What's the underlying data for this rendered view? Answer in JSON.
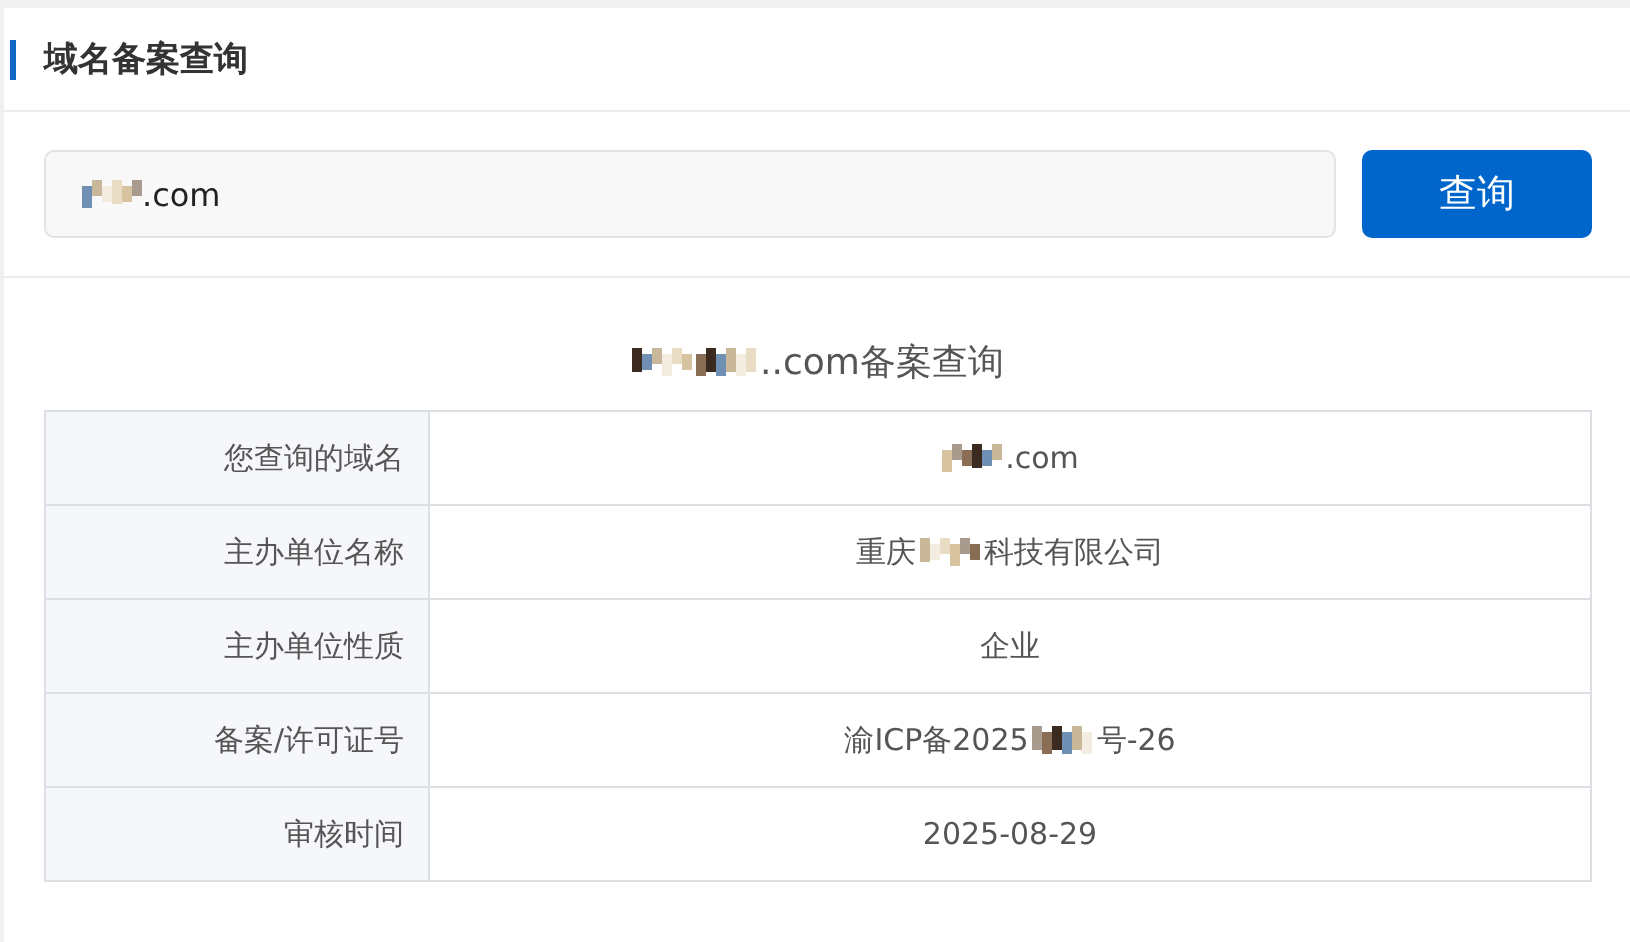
{
  "panel": {
    "title": "域名备案查询"
  },
  "search": {
    "value": [
      {
        "kind": "mosaic"
      },
      {
        "kind": "text",
        "text": ".com"
      }
    ],
    "button": "查询"
  },
  "result": {
    "title": [
      {
        "kind": "mosaic"
      },
      {
        "kind": "mosaic"
      },
      {
        "kind": "text",
        "text": "..com备案查询"
      }
    ],
    "rows": [
      {
        "label": "您查询的域名",
        "value": [
          {
            "kind": "mosaic"
          },
          {
            "kind": "text",
            "text": ".com"
          }
        ]
      },
      {
        "label": "主办单位名称",
        "value": [
          {
            "kind": "text",
            "text": "重庆"
          },
          {
            "kind": "mosaic"
          },
          {
            "kind": "text",
            "text": "科技有限公司"
          }
        ]
      },
      {
        "label": "主办单位性质",
        "value": [
          {
            "kind": "text",
            "text": "企业"
          }
        ]
      },
      {
        "label": "备案/许可证号",
        "value": [
          {
            "kind": "text",
            "text": "渝ICP备2025"
          },
          {
            "kind": "mosaic"
          },
          {
            "kind": "text",
            "text": "号-26"
          }
        ]
      },
      {
        "label": "审核时间",
        "value": [
          {
            "kind": "text",
            "text": "2025-08-29"
          }
        ]
      }
    ]
  }
}
